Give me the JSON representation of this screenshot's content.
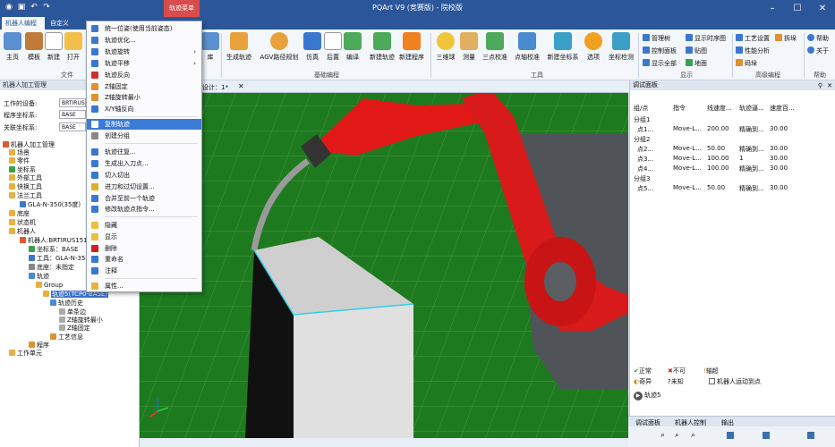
{
  "titlebar": {
    "title": "PQArt V9 (竞赛版) - 院校版",
    "context_tab": "轨迹菜单"
  },
  "tabs": {
    "robot_prog": "机器人编程",
    "custom": "自定义"
  },
  "ribbon": {
    "file_buttons": [
      "主页",
      "模板",
      "新建",
      "打开"
    ],
    "file_group": "文件",
    "prog_buttons": [
      "库",
      "生成轨迹",
      "AGV路径规划",
      "仿真",
      "后置",
      "编译",
      "新建轨迹",
      "新建程序"
    ],
    "prog_group": "基础编程",
    "tool_buttons": [
      "三维球",
      "测量",
      "三点校准",
      "点轴校准",
      "新建坐标系",
      "选项",
      "坐标检测"
    ],
    "tool_group": "工具",
    "display_items": [
      "管理树",
      "控制面板",
      "显示全部",
      "显示时序图",
      "贴图",
      "地面"
    ],
    "display_group": "显示",
    "adv_items": [
      "工艺设置",
      "性能分析",
      "码垛",
      "拆垛"
    ],
    "adv_group": "高级编程",
    "help_items": [
      "帮助",
      "关于"
    ],
    "help_group": "帮助"
  },
  "left_panel": {
    "title": "机器人加工管理",
    "device_label": "工作的设备:",
    "device_value": "BRTIRUS",
    "prog_coord_label": "程序坐标系:",
    "prog_coord_value": "BASE",
    "assoc_coord_label": "关联坐标系:",
    "assoc_coord_value": "BASE",
    "tree": [
      "机器人加工管理",
      "场景",
      "零件",
      "坐标系",
      "外部工具",
      "快换工具",
      "法兰工具",
      "GLA-N-350(35度)",
      "底座",
      "状态机",
      "机器人",
      "机器人:BRTIRUS1510A",
      "坐标系：BASE",
      "工具：GLA-N-350(",
      "底座：未指定",
      "轨迹",
      "Group",
      "轨迹5(TCP0-BASE)",
      "轨迹历史",
      "单条边",
      "Z轴旋转最小",
      "Z轴固定",
      "工艺信息",
      "程序",
      "工作单元"
    ]
  },
  "viewport": {
    "tab": "设计：1*"
  },
  "context_menu": {
    "items": [
      "统一位姿(使用当前姿态)",
      "轨迹优化...",
      "轨迹旋转",
      "轨迹平移",
      "轨迹反向",
      "Z轴固定",
      "Z轴旋转最小",
      "X/Y轴反向",
      "复制轨迹",
      "创建分组",
      "轨迹往复...",
      "生成出入刀点...",
      "切入切出",
      "进刀和过切设置...",
      "合并至前一个轨迹",
      "修改轨迹点指令...",
      "隐藏",
      "显示",
      "删除",
      "重命名",
      "注释",
      "属性..."
    ]
  },
  "debug_panel": {
    "title": "调试面板",
    "columns": [
      "组/点",
      "指令",
      "线速度...",
      "轨迹逼...",
      "速度百..."
    ],
    "rows": [
      {
        "name": "分组1",
        "cmd": "",
        "speed": "",
        "approx": "",
        "pct": ""
      },
      {
        "name": "点1...",
        "cmd": "Move-L...",
        "speed": "200.00",
        "approx": "精确到...",
        "pct": "30.00"
      },
      {
        "name": "分组2",
        "cmd": "",
        "speed": "",
        "approx": "",
        "pct": ""
      },
      {
        "name": "点2...",
        "cmd": "Move-L...",
        "speed": "50.00",
        "approx": "精确到...",
        "pct": "30.00"
      },
      {
        "name": "点3...",
        "cmd": "Move-L...",
        "speed": "100.00",
        "approx": "1",
        "pct": "30.00"
      },
      {
        "name": "点4...",
        "cmd": "Move-L...",
        "speed": "100.00",
        "approx": "精确到...",
        "pct": "30.00"
      },
      {
        "name": "分组3",
        "cmd": "",
        "speed": "",
        "approx": "",
        "pct": ""
      },
      {
        "name": "点5...",
        "cmd": "Move-L...",
        "speed": "50.00",
        "approx": "精确到...",
        "pct": "30.00"
      }
    ],
    "legend": {
      "normal": "正常",
      "no": "不可",
      "limit": "轴超",
      "odd": "奇异",
      "unknown": "未知",
      "robot_move": "机器人运动到点"
    },
    "track": "轨迹5",
    "bottom_tabs": [
      "调试面板",
      "机器人控制",
      "输出"
    ]
  },
  "colors": {
    "title_blue": "#2b579a",
    "context_red": "#d84c4c",
    "viewport_green": "#1e7a1e",
    "robot_red": "#e01818",
    "highlight": "#3b7bd8"
  }
}
